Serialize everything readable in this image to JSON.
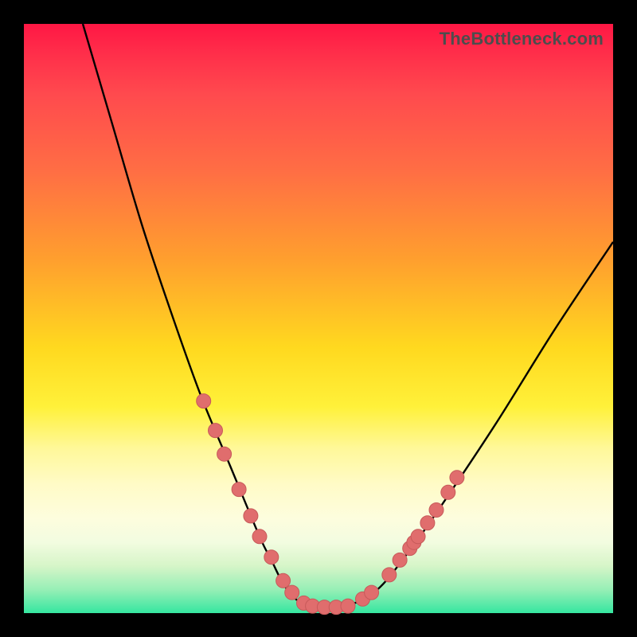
{
  "watermark": "TheBottleneck.com",
  "colors": {
    "marker_fill": "#e06d6d",
    "marker_stroke": "#c75a5a",
    "curve_stroke": "#000000",
    "frame": "#000000"
  },
  "chart_data": {
    "type": "line",
    "title": "",
    "xlabel": "",
    "ylabel": "",
    "xlim": [
      0,
      100
    ],
    "ylim": [
      0,
      100
    ],
    "grid": false,
    "series": [
      {
        "name": "bottleneck-curve",
        "x": [
          10,
          15,
          20,
          25,
          30,
          35,
          40,
          42,
          44,
          46,
          48,
          50,
          55,
          60,
          65,
          70,
          80,
          90,
          100
        ],
        "y": [
          100,
          83,
          66,
          51,
          37,
          25,
          13,
          9,
          5,
          2.5,
          1.3,
          1,
          1.3,
          4,
          10,
          17,
          32,
          48,
          63
        ]
      }
    ],
    "markers": [
      {
        "x": 30.5,
        "y": 36
      },
      {
        "x": 32.5,
        "y": 31
      },
      {
        "x": 34.0,
        "y": 27
      },
      {
        "x": 36.5,
        "y": 21
      },
      {
        "x": 38.5,
        "y": 16.5
      },
      {
        "x": 40.0,
        "y": 13
      },
      {
        "x": 42.0,
        "y": 9.5
      },
      {
        "x": 44.0,
        "y": 5.5
      },
      {
        "x": 45.5,
        "y": 3.5
      },
      {
        "x": 47.5,
        "y": 1.7
      },
      {
        "x": 49.0,
        "y": 1.2
      },
      {
        "x": 51.0,
        "y": 1.0
      },
      {
        "x": 53.0,
        "y": 1.0
      },
      {
        "x": 55.0,
        "y": 1.2
      },
      {
        "x": 57.5,
        "y": 2.4
      },
      {
        "x": 59.0,
        "y": 3.5
      },
      {
        "x": 62.0,
        "y": 6.5
      },
      {
        "x": 63.8,
        "y": 9.0
      },
      {
        "x": 65.5,
        "y": 11.0
      },
      {
        "x": 66.2,
        "y": 12.0
      },
      {
        "x": 66.9,
        "y": 13.0
      },
      {
        "x": 68.5,
        "y": 15.3
      },
      {
        "x": 70.0,
        "y": 17.5
      },
      {
        "x": 72.0,
        "y": 20.5
      },
      {
        "x": 73.5,
        "y": 23.0
      }
    ],
    "background_bands": [
      {
        "from": 100,
        "to": 75,
        "desc": "red-orange"
      },
      {
        "from": 75,
        "to": 35,
        "desc": "orange-yellow"
      },
      {
        "from": 35,
        "to": 12,
        "desc": "pale-yellow"
      },
      {
        "from": 12,
        "to": 3,
        "desc": "yellow-green"
      },
      {
        "from": 3,
        "to": 0,
        "desc": "green"
      }
    ],
    "annotations": [
      {
        "text": "TheBottleneck.com",
        "position": "top-right"
      }
    ]
  }
}
